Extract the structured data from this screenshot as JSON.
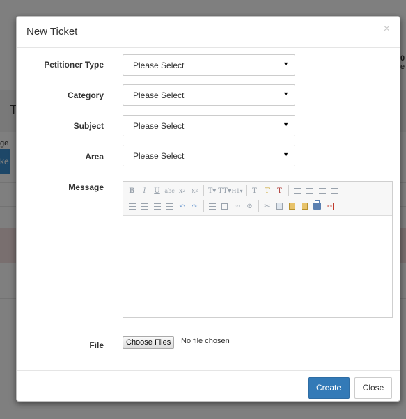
{
  "background": {
    "heading_fragment": "T",
    "left_fragment_1": "ge",
    "left_fragment_2": "ke",
    "right_fragment_1": "0",
    "right_fragment_2": "e"
  },
  "modal": {
    "title": "New Ticket",
    "close_glyph": "×",
    "fields": {
      "petitioner_type": {
        "label": "Petitioner Type",
        "value": "Please Select"
      },
      "category": {
        "label": "Category",
        "value": "Please Select"
      },
      "subject": {
        "label": "Subject",
        "value": "Please Select"
      },
      "area": {
        "label": "Area",
        "value": "Please Select"
      }
    },
    "select_caret": "▼",
    "message": {
      "label": "Message"
    },
    "editor": {
      "toolbar_row1": [
        "bold",
        "italic",
        "underline",
        "strikethrough",
        "subscript",
        "superscript",
        "font-size",
        "text-height",
        "heading",
        "clean-format",
        "highlight",
        "remove-format",
        "bulleted-list",
        "numbered-list",
        "indent",
        "outdent"
      ],
      "toolbar_row2": [
        "align-left",
        "align-center",
        "align-right",
        "justify",
        "undo",
        "redo",
        "horizontal-rule",
        "image",
        "link",
        "unlink",
        "cut",
        "copy",
        "paste",
        "paste-text",
        "print",
        "source"
      ]
    },
    "file": {
      "label": "File",
      "button_label": "Choose Files",
      "status": "No file chosen"
    },
    "footer": {
      "create_label": "Create",
      "close_label": "Close"
    }
  },
  "colors": {
    "primary": "#337ab7",
    "backdrop": "rgba(0,0,0,0.5)"
  }
}
